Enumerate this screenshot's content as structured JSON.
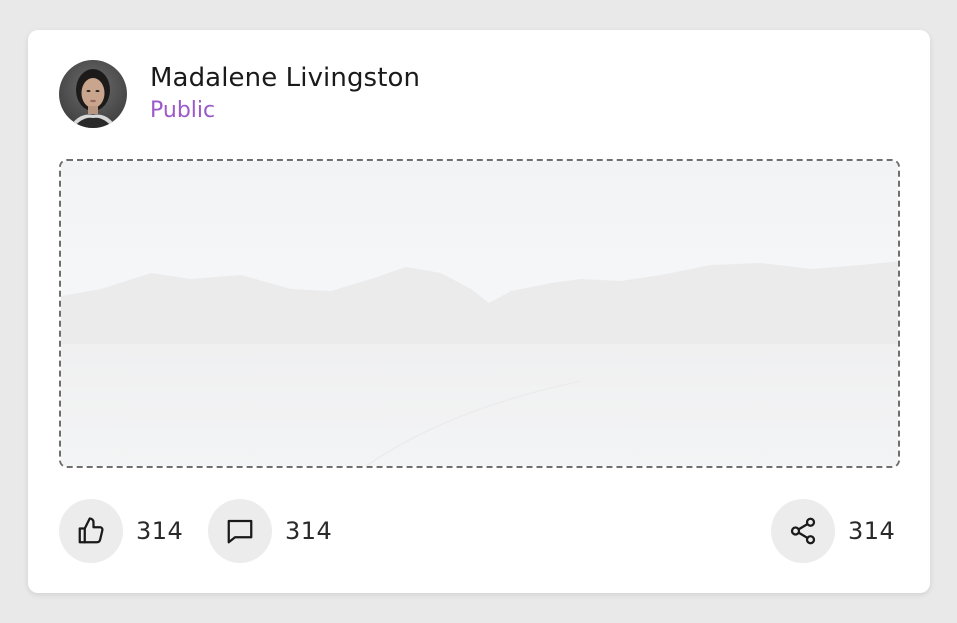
{
  "post": {
    "author_name": "Madalene Livingston",
    "visibility": "Public",
    "visibility_color": "#9b59c9",
    "image_alt": "landscape-photo",
    "actions": {
      "like": {
        "icon": "thumbs-up-icon",
        "count": "314"
      },
      "comment": {
        "icon": "comment-icon",
        "count": "314"
      },
      "share": {
        "icon": "share-icon",
        "count": "314"
      }
    }
  }
}
